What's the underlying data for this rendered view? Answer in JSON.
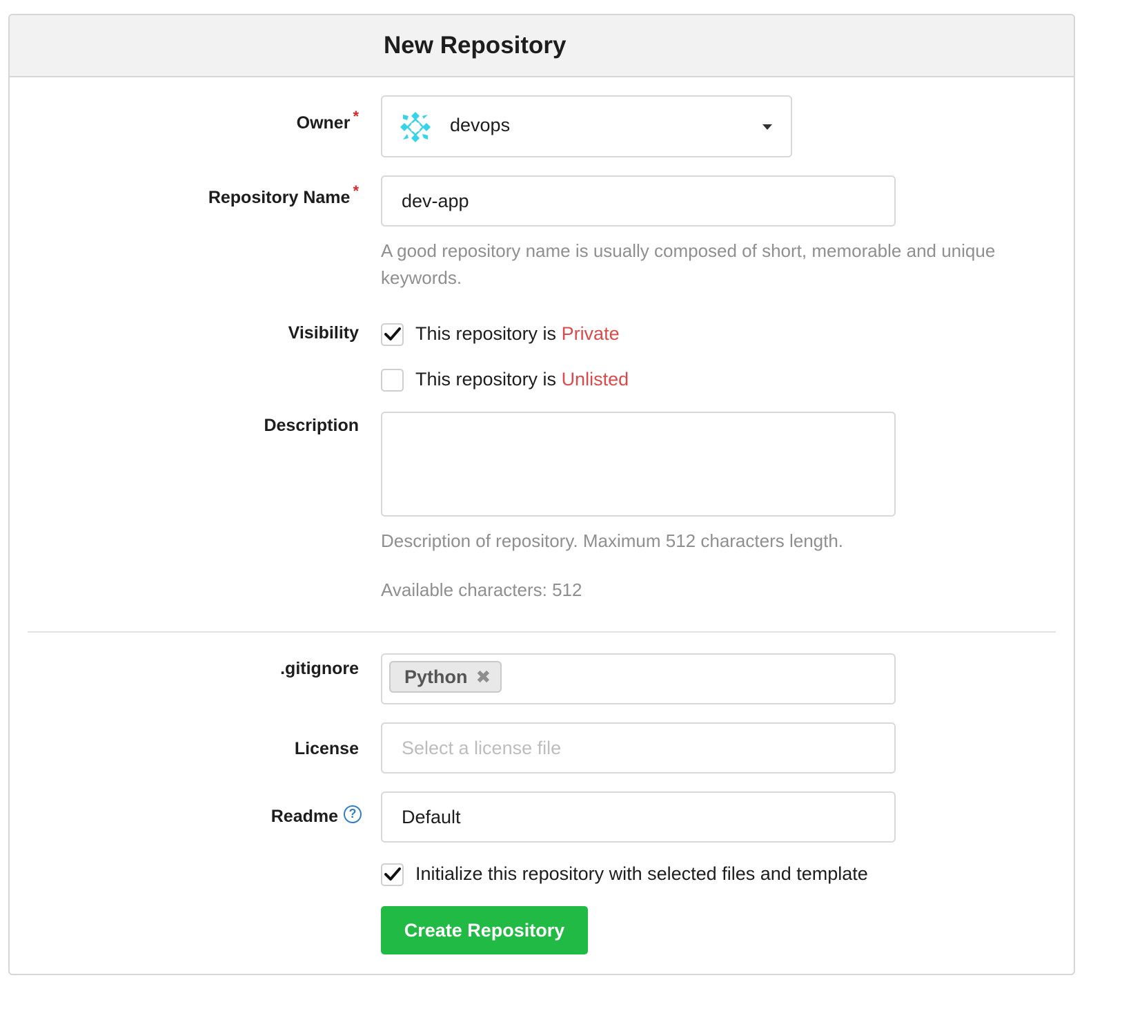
{
  "header": {
    "title": "New Repository"
  },
  "owner": {
    "label": "Owner",
    "required_mark": "*",
    "value": "devops",
    "avatar_icon": "devops-avatar-icon",
    "dropdown_icon": "caret-down-icon"
  },
  "repo_name": {
    "label": "Repository Name",
    "required_mark": "*",
    "value": "dev-app",
    "help": "A good repository name is usually composed of short, memorable and unique keywords."
  },
  "visibility": {
    "label": "Visibility",
    "private": {
      "prefix": "This repository is ",
      "accent": "Private",
      "checked": true
    },
    "unlisted": {
      "prefix": "This repository is ",
      "accent": "Unlisted",
      "checked": false
    }
  },
  "description": {
    "label": "Description",
    "value": "",
    "help": "Description of repository. Maximum 512 characters length.",
    "available": "Available characters: 512"
  },
  "gitignore": {
    "label": ".gitignore",
    "selected_tag": "Python",
    "remove_symbol": "✖"
  },
  "license": {
    "label": "License",
    "placeholder": "Select a license file"
  },
  "readme": {
    "label": "Readme",
    "help_symbol": "?",
    "value": "Default"
  },
  "initialize": {
    "label": "Initialize this repository with selected files and template",
    "checked": true
  },
  "actions": {
    "create_label": "Create Repository"
  },
  "colors": {
    "required": "#db2828",
    "accent_text": "#db4a4a",
    "primary_button": "#21ba45",
    "help_icon": "#2f80c8"
  }
}
